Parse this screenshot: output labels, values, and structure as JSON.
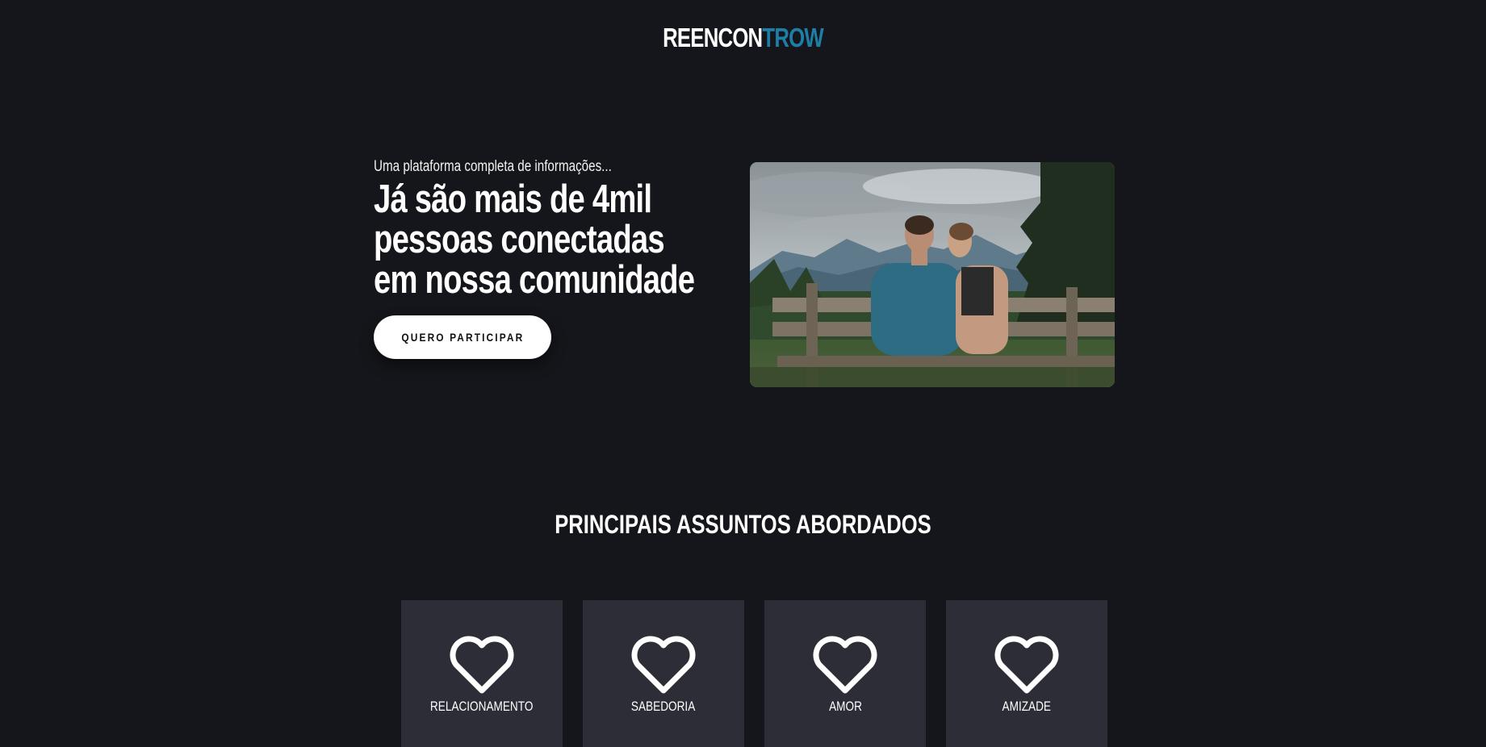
{
  "header": {
    "logo_part1": "REENCON",
    "logo_part2": "TROW",
    "logo_accent_color": "#1d7fa6"
  },
  "hero": {
    "kicker": "Uma plataforma completa de informações...",
    "headline_line1": "Já são mais de 4mil",
    "headline_line2": "pessoas conectadas",
    "headline_line3": "em nossa comunidade",
    "cta_label": "QUERO PARTICIPAR",
    "image_icon": "couple-on-bench-photo"
  },
  "topics": {
    "title": "PRINCIPAIS ASSUNTOS ABORDADOS",
    "items": [
      {
        "label": "RELACIONAMENTO",
        "icon": "heart-icon"
      },
      {
        "label": "SABEDORIA",
        "icon": "heart-icon"
      },
      {
        "label": "AMOR",
        "icon": "heart-icon"
      },
      {
        "label": "AMIZADE",
        "icon": "heart-icon"
      }
    ]
  },
  "colors": {
    "background": "#15161b",
    "card": "#2c2d36",
    "accent": "#1d7fa6"
  }
}
